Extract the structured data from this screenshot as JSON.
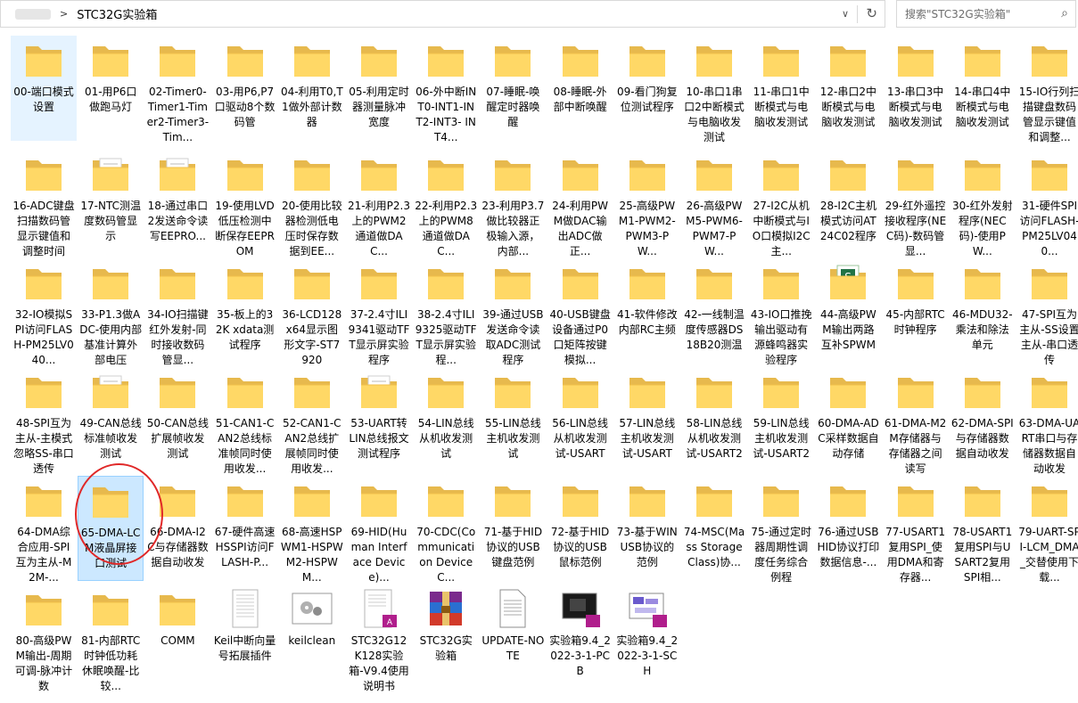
{
  "address": {
    "path": "STC32G实验箱",
    "separator": ">"
  },
  "search": {
    "placeholder": "搜索\"STC32G实验箱\""
  },
  "items": [
    {
      "label": "00-端口模式设置",
      "type": "folder",
      "state": "selected"
    },
    {
      "label": "01-用P6口做跑马灯",
      "type": "folder"
    },
    {
      "label": "02-Timer0-Timer1-Timer2-Timer3-Tim...",
      "type": "folder"
    },
    {
      "label": "03-用P6,P7口驱动8个数码管",
      "type": "folder"
    },
    {
      "label": "04-利用T0,T1做外部计数器",
      "type": "folder"
    },
    {
      "label": "05-利用定时器测量脉冲宽度",
      "type": "folder"
    },
    {
      "label": "06-外中断INT0-INT1-INT2-INT3- INT4...",
      "type": "folder"
    },
    {
      "label": "07-睡眠-唤醒定时器唤醒",
      "type": "folder"
    },
    {
      "label": "08-睡眠-外部中断唤醒",
      "type": "folder"
    },
    {
      "label": "09-看门狗复位测试程序",
      "type": "folder"
    },
    {
      "label": "10-串口1串口2中断模式与电脑收发测试",
      "type": "folder"
    },
    {
      "label": "11-串口1中断模式与电脑收发测试",
      "type": "folder"
    },
    {
      "label": "12-串口2中断模式与电脑收发测试",
      "type": "folder"
    },
    {
      "label": "13-串口3中断模式与电脑收发测试",
      "type": "folder"
    },
    {
      "label": "14-串口4中断模式与电脑收发测试",
      "type": "folder"
    },
    {
      "label": "15-IO行列扫描键盘数码管显示键值和调整...",
      "type": "folder"
    },
    {
      "label": "16-ADC键盘扫描数码管显示键值和调整时间",
      "type": "folder"
    },
    {
      "label": "17-NTC测温度数码管显示",
      "type": "folder-doc"
    },
    {
      "label": "18-通过串口2发送命令读写EEPRO...",
      "type": "folder-doc"
    },
    {
      "label": "19-使用LVD低压检测中断保存EEPROM",
      "type": "folder"
    },
    {
      "label": "20-使用比较器检测低电压时保存数据到EE...",
      "type": "folder"
    },
    {
      "label": "21-利用P2.3上的PWM2通道做DAC...",
      "type": "folder"
    },
    {
      "label": "22-利用P2.3上的PWM8通道做DAC...",
      "type": "folder"
    },
    {
      "label": "23-利用P3.7做比较器正极输入源，内部...",
      "type": "folder"
    },
    {
      "label": "24-利用PWM做DAC输出ADC做正...",
      "type": "folder"
    },
    {
      "label": "25-高级PWM1-PWM2-PWM3-PW...",
      "type": "folder"
    },
    {
      "label": "26-高级PWM5-PWM6-PWM7-PW...",
      "type": "folder"
    },
    {
      "label": "27-I2C从机中断模式与IO口模拟I2C主...",
      "type": "folder"
    },
    {
      "label": "28-I2C主机模式访问AT24C02程序",
      "type": "folder"
    },
    {
      "label": "29-红外遥控接收程序(NEC码)-数码管显...",
      "type": "folder"
    },
    {
      "label": "30-红外发射程序(NEC码)-使用PW...",
      "type": "folder"
    },
    {
      "label": "31-硬件SPI访问FLASH-PM25LV040...",
      "type": "folder"
    },
    {
      "label": "32-IO模拟SPI访问FLASH-PM25LV040...",
      "type": "folder"
    },
    {
      "label": "33-P1.3做ADC-使用内部基准计算外部电压",
      "type": "folder"
    },
    {
      "label": "34-IO扫描键红外发射-同时接收数码管显...",
      "type": "folder"
    },
    {
      "label": "35-板上的32K xdata测试程序",
      "type": "folder"
    },
    {
      "label": "36-LCD128x64显示图形文字-ST7920",
      "type": "folder"
    },
    {
      "label": "37-2.4寸ILI9341驱动TFT显示屏实验程序",
      "type": "folder"
    },
    {
      "label": "38-2.4寸ILI9325驱动TFT显示屏实验程...",
      "type": "folder"
    },
    {
      "label": "39-通过USB发送命令读取ADC测试程序",
      "type": "folder"
    },
    {
      "label": "40-USB键盘设备通过P0口矩阵按键模拟...",
      "type": "folder"
    },
    {
      "label": "41-软件修改内部RC主频",
      "type": "folder"
    },
    {
      "label": "42-一线制温度传感器DS18B20测温",
      "type": "folder"
    },
    {
      "label": "43-IO口推挽输出驱动有源蜂鸣器实验程序",
      "type": "folder"
    },
    {
      "label": "44-高级PWM输出两路互补SPWM",
      "type": "folder-excel"
    },
    {
      "label": "45-内部RTC时钟程序",
      "type": "folder"
    },
    {
      "label": "46-MDU32-乘法和除法单元",
      "type": "folder"
    },
    {
      "label": "47-SPI互为主从-SS设置主从-串口透传",
      "type": "folder"
    },
    {
      "label": "48-SPI互为主从-主模式忽略SS-串口透传",
      "type": "folder"
    },
    {
      "label": "49-CAN总线标准帧收发测试",
      "type": "folder-doc"
    },
    {
      "label": "50-CAN总线扩展帧收发测试",
      "type": "folder"
    },
    {
      "label": "51-CAN1-CAN2总线标准帧同时使用收发...",
      "type": "folder"
    },
    {
      "label": "52-CAN1-CAN2总线扩展帧同时使用收发...",
      "type": "folder"
    },
    {
      "label": "53-UART转LIN总线报文测试程序",
      "type": "folder-doc"
    },
    {
      "label": "54-LIN总线从机收发测试",
      "type": "folder"
    },
    {
      "label": "55-LIN总线主机收发测试",
      "type": "folder"
    },
    {
      "label": "56-LIN总线从机收发测试-USART",
      "type": "folder"
    },
    {
      "label": "57-LIN总线主机收发测试-USART",
      "type": "folder"
    },
    {
      "label": "58-LIN总线从机收发测试-USART2",
      "type": "folder"
    },
    {
      "label": "59-LIN总线主机收发测试-USART2",
      "type": "folder"
    },
    {
      "label": "60-DMA-ADC采样数据自动存储",
      "type": "folder"
    },
    {
      "label": "61-DMA-M2M存储器与存储器之间读写",
      "type": "folder"
    },
    {
      "label": "62-DMA-SPI与存储器数据自动收发",
      "type": "folder"
    },
    {
      "label": "63-DMA-UART串口与存储器数据自动收发",
      "type": "folder"
    },
    {
      "label": "64-DMA综合应用-SPI互为主从-M2M-...",
      "type": "folder"
    },
    {
      "label": "65-DMA-LCM液晶屏接口测试",
      "type": "folder",
      "state": "selected"
    },
    {
      "label": "66-DMA-I2C与存储器数据自动收发",
      "type": "folder"
    },
    {
      "label": "67-硬件高速HSSPI访问FLASH-P...",
      "type": "folder"
    },
    {
      "label": "68-高速HSPWM1-HSPWM2-HSPWM...",
      "type": "folder"
    },
    {
      "label": "69-HID(Human Interface Device)...",
      "type": "folder"
    },
    {
      "label": "70-CDC(Communication Device C...",
      "type": "folder"
    },
    {
      "label": "71-基于HID协议的USB键盘范例",
      "type": "folder"
    },
    {
      "label": "72-基于HID协议的USB鼠标范例",
      "type": "folder"
    },
    {
      "label": "73-基于WINUSB协议的范例",
      "type": "folder"
    },
    {
      "label": "74-MSC(Mass Storage Class)协...",
      "type": "folder"
    },
    {
      "label": "75-通过定时器周期性调度任务综合例程",
      "type": "folder"
    },
    {
      "label": "76-通过USB HID协议打印数据信息-...",
      "type": "folder"
    },
    {
      "label": "77-USART1复用SPI_使用DMA和寄存器...",
      "type": "folder"
    },
    {
      "label": "78-USART1复用SPI与USART2复用SPI相...",
      "type": "folder"
    },
    {
      "label": "79-UART-SPI-LCM_DMA_交替使用下载...",
      "type": "folder"
    },
    {
      "label": "80-高级PWM输出-周期可调-脉冲计数",
      "type": "folder"
    },
    {
      "label": "81-内部RTC时钟低功耗休眠唤醒-比较...",
      "type": "folder"
    },
    {
      "label": "COMM",
      "type": "folder"
    },
    {
      "label": "Keil中断向量号拓展插件",
      "type": "document"
    },
    {
      "label": "keilclean",
      "type": "settings-file"
    },
    {
      "label": "STC32G12K128实验箱-V9.4使用说明书",
      "type": "pdf"
    },
    {
      "label": "STC32G实验箱",
      "type": "archive"
    },
    {
      "label": "UPDATE-NOTE",
      "type": "text-file"
    },
    {
      "label": "实验箱9.4_2022-3-1-PCB",
      "type": "pdf-image-dark"
    },
    {
      "label": "实验箱9.4_2022-3-1-SCH",
      "type": "pdf-image-schematic"
    }
  ],
  "colors": {
    "folder_back": "#e7b94d",
    "folder_front": "#ffd866",
    "selection_bg": "#cce8ff",
    "annotation_circle": "#e02828",
    "pdf_badge": "#b01e8c"
  }
}
